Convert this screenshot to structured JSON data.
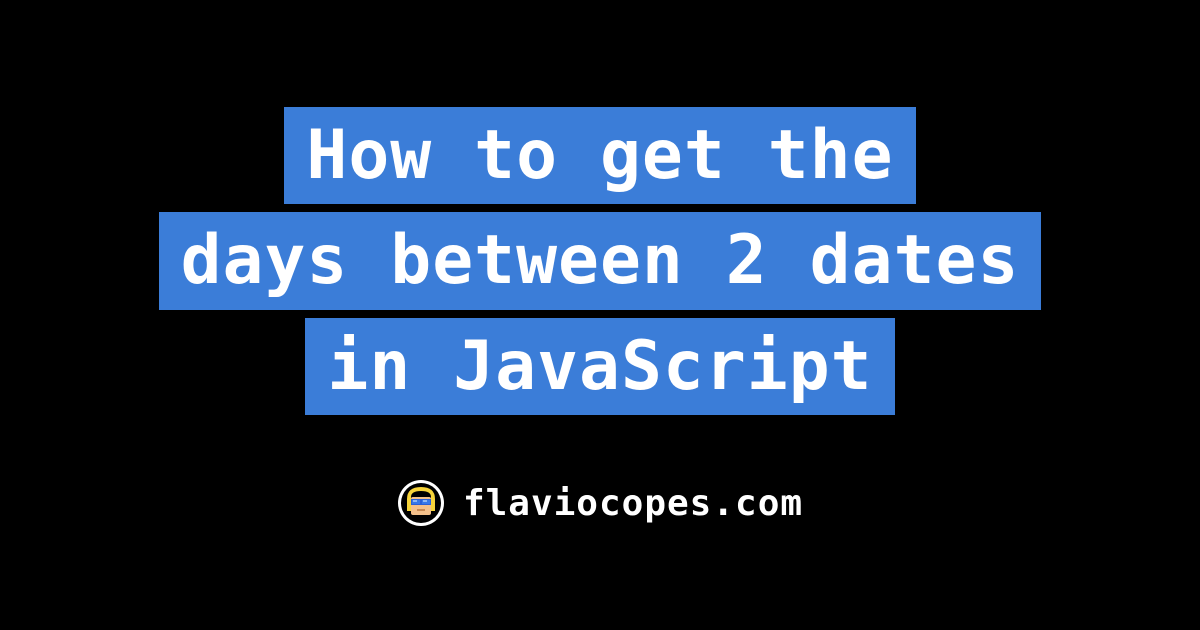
{
  "title": {
    "line1": "How to get the",
    "line2": "days between 2 dates",
    "line3": "in JavaScript"
  },
  "footer": {
    "site_name": "flaviocopes.com"
  },
  "colors": {
    "background": "#000000",
    "highlight": "#3b7dd8",
    "text": "#ffffff"
  }
}
